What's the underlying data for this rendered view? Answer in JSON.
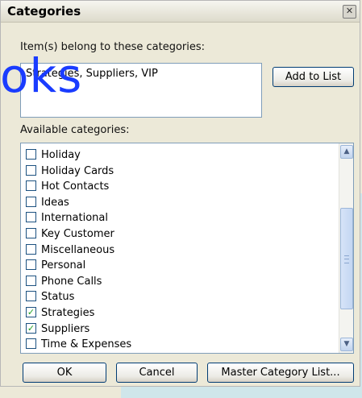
{
  "dialog": {
    "title": "Categories",
    "assigned_label": "Item(s) belong to these categories:",
    "assigned_value": "Strategies, Suppliers, VIP",
    "add_button": "Add to List",
    "available_label": "Available categories:",
    "categories": [
      {
        "label": "Holiday",
        "checked": false
      },
      {
        "label": "Holiday Cards",
        "checked": false
      },
      {
        "label": "Hot Contacts",
        "checked": false
      },
      {
        "label": "Ideas",
        "checked": false
      },
      {
        "label": "International",
        "checked": false
      },
      {
        "label": "Key Customer",
        "checked": false
      },
      {
        "label": "Miscellaneous",
        "checked": false
      },
      {
        "label": "Personal",
        "checked": false
      },
      {
        "label": "Phone Calls",
        "checked": false
      },
      {
        "label": "Status",
        "checked": false
      },
      {
        "label": "Strategies",
        "checked": true
      },
      {
        "label": "Suppliers",
        "checked": true
      },
      {
        "label": "Time & Expenses",
        "checked": false
      }
    ],
    "ok_button": "OK",
    "cancel_button": "Cancel",
    "master_button": "Master Category List..."
  },
  "watermark": "oks",
  "colors": {
    "dialog_bg": "#ece9d8",
    "check_green": "#21a121",
    "watermark_blue": "#1a3cff"
  }
}
